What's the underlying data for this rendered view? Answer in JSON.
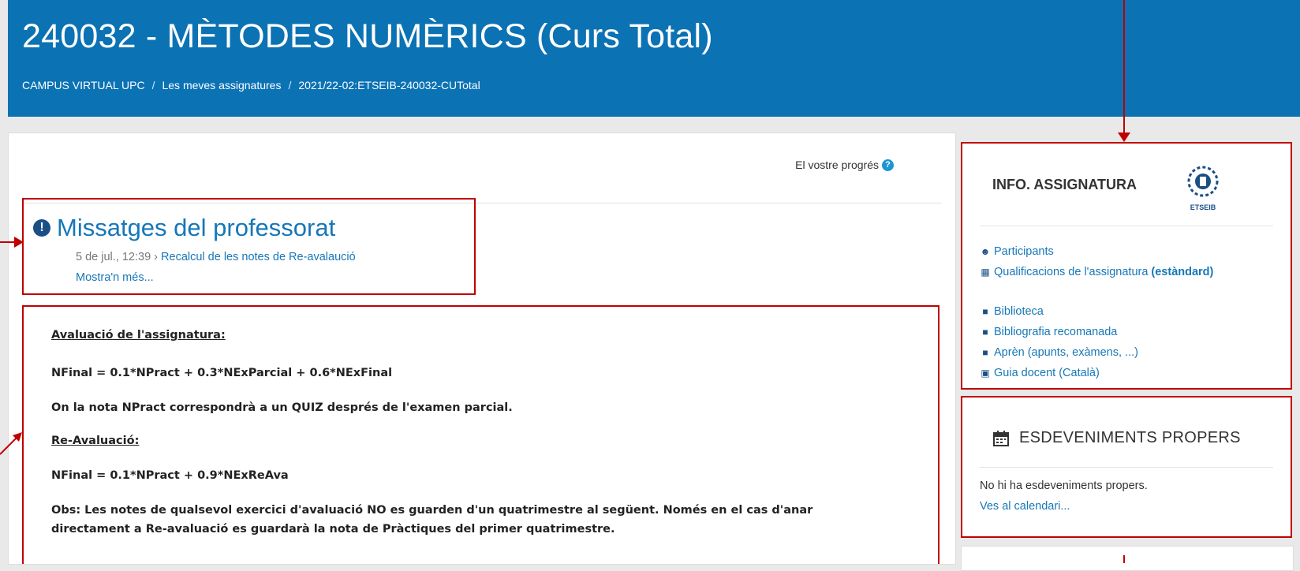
{
  "header": {
    "course_title": "240032 - MÈTODES NUMÈRICS (Curs Total)",
    "breadcrumb": [
      "CAMPUS VIRTUAL UPC",
      "Les meves assignatures",
      "2021/22-02:ETSEIB-240032-CUTotal"
    ],
    "background": "#0b72b4"
  },
  "main": {
    "progress_label": "El vostre progrés",
    "messages": {
      "title": "Missatges del professorat",
      "date": "5 de jul., 12:39",
      "item_link": "Recalcul de les notes de Re-avalaució",
      "more": "Mostra'n més..."
    },
    "evaluation": {
      "heading": "Avaluació de l'assignatura:",
      "formula": "NFinal = 0.1*NPract + 0.3*NExParcial + 0.6*NExFinal",
      "note_prefix": "On la nota ",
      "note_bold": "NPract",
      "note_suffix": " correspondrà a un QUIZ després de l'examen parcial.",
      "reeval_heading": "Re-Avaluació:",
      "reeval_formula": "NFinal = 0.1*NPract + 0.9*NExReAva",
      "obs_line1": "Obs: Les notes de qualsevol exercici d'avaluació NO es guarden d'un quatrimestre al següent. Només en el cas d'anar",
      "obs_line2": "directament a Re-avaluació es guardarà la nota de Pràctiques del primer quatrimestre."
    }
  },
  "sidebar": {
    "info_title": "INFO. ASSIGNATURA",
    "logo_text": "ETSEIB",
    "links": [
      {
        "icon": "users-icon",
        "label": "Participants"
      },
      {
        "icon": "table-icon",
        "label": "Qualificacions de l'assignatura",
        "suffix": "(estàndard)"
      },
      {
        "icon": "book-icon",
        "label": "Biblioteca"
      },
      {
        "icon": "book-icon",
        "label": "Bibliografia recomanada"
      },
      {
        "icon": "book-icon",
        "label": "Aprèn (apunts, exàmens, ...)"
      },
      {
        "icon": "file-icon",
        "label": "Guia docent (Català)"
      }
    ],
    "events_title": "ESDEVENIMENTS PROPERS",
    "events_none": "No hi ha esdeveniments propers.",
    "events_link": "Ves al calendari..."
  },
  "annotation_color": "#c00000"
}
